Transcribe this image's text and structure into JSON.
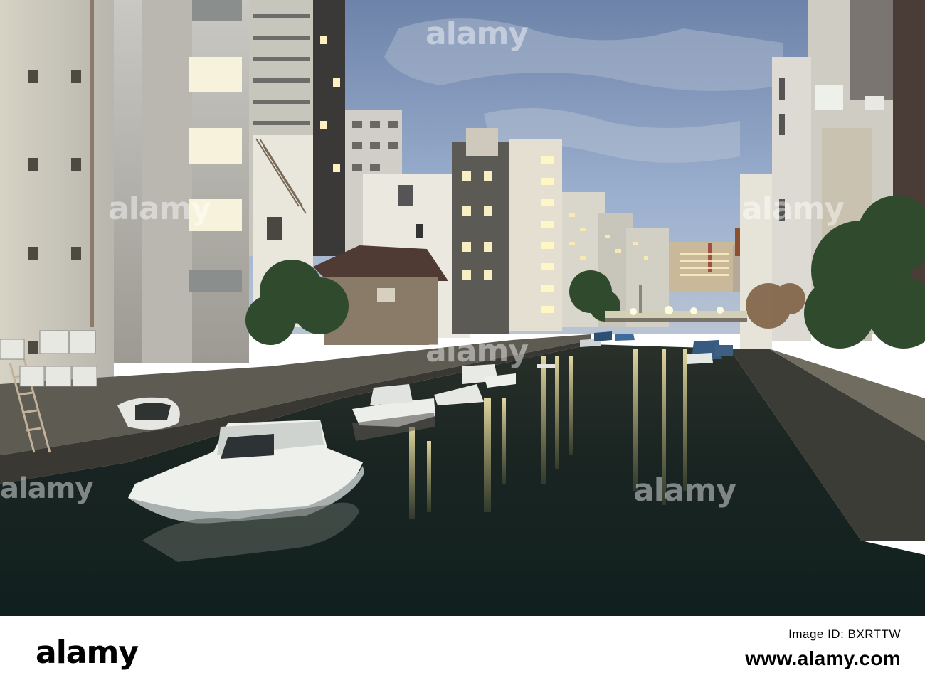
{
  "watermark": {
    "text": "alamy"
  },
  "footer": {
    "logo": "alamy",
    "image_id": "Image ID: BXRTTW",
    "url": "www.alamy.com"
  },
  "colors": {
    "sky": "#8aa0c3",
    "water": "#15221f",
    "footer_bg": "#ffffff"
  }
}
